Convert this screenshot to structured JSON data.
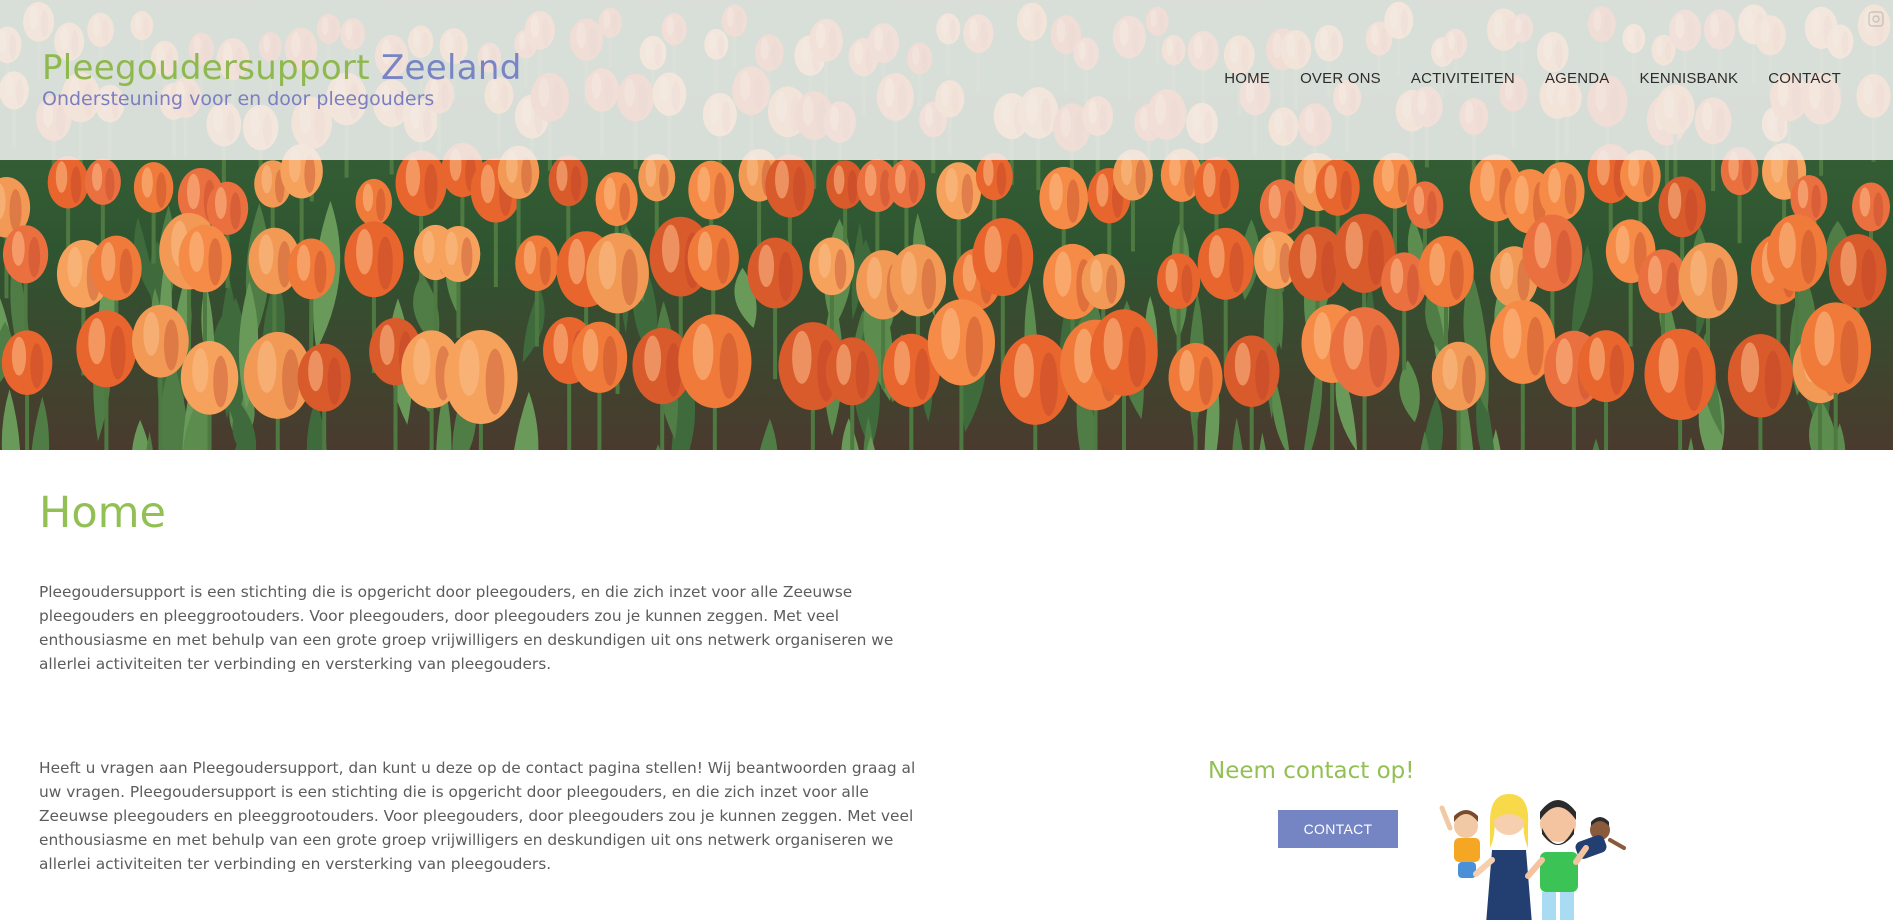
{
  "header": {
    "brand_title_part1": "Pleegoudersupport",
    "brand_title_part2": "Zeeland",
    "tagline": "Ondersteuning voor en door pleegouders"
  },
  "nav": {
    "items": [
      {
        "label": "HOME"
      },
      {
        "label": "OVER ONS"
      },
      {
        "label": "ACTIVITEITEN"
      },
      {
        "label": "AGENDA"
      },
      {
        "label": "KENNISBANK"
      },
      {
        "label": "CONTACT"
      }
    ]
  },
  "main": {
    "title": "Home",
    "paragraph_1": "Pleegoudersupport is een stichting die is opgericht door pleegouders, en die zich inzet voor alle Zeeuwse pleegouders en pleeggrootouders. Voor pleegouders, door pleegouders zou je kunnen zeggen. Met veel enthousiasme en met behulp van een grote groep vrijwilligers en deskundigen uit ons netwerk organiseren we allerlei activiteiten ter verbinding en versterking van pleegouders.",
    "paragraph_2": "Heeft u vragen aan Pleegoudersupport, dan kunt u deze op de contact pagina stellen! Wij beantwoorden graag al uw vragen. Pleegoudersupport is een stichting die is opgericht door pleegouders, en die zich inzet voor alle Zeeuwse pleegouders en pleeggrootouders. Voor pleegouders, door pleegouders zou je kunnen zeggen. Met veel enthousiasme en met behulp van een grote groep vrijwilligers en deskundigen uit ons netwerk organiseren we allerlei activiteiten ter verbinding en versterking van pleegouders."
  },
  "contact_cta": {
    "title": "Neem contact op!",
    "button_label": "CONTACT"
  },
  "colors": {
    "brand_green": "#93c055",
    "brand_blue": "#7884c4",
    "button_bg": "#7585c4",
    "tulip_orange": "#f07a3a"
  },
  "icons": [
    "expand-icon",
    "family-illustration",
    "tulip-field-image"
  ]
}
